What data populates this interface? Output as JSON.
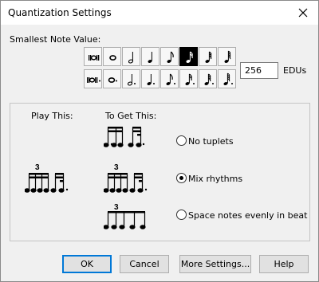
{
  "window": {
    "title": "Quantization Settings",
    "close_glyph": "close-icon"
  },
  "smallest_note": {
    "label": "Smallest Note Value:",
    "rows": [
      [
        "breve-double",
        "whole",
        "half",
        "quarter",
        "eighth",
        "16th",
        "32nd",
        "64th"
      ],
      [
        "dotted-breve-double",
        "dotted-whole",
        "dotted-half",
        "dotted-quarter",
        "dotted-eighth",
        "dotted-16th",
        "dotted-32nd",
        "dotted-64th"
      ]
    ],
    "selected": "16th",
    "edus_value": "256",
    "edus_label": "EDUs"
  },
  "playback": {
    "play_label": "Play This:",
    "get_label": "To Get This:",
    "triplet_marker": "3",
    "options": [
      {
        "label": "No tuplets",
        "checked": false
      },
      {
        "label": "Mix rhythms",
        "checked": true
      },
      {
        "label": "Space notes evenly in beat",
        "checked": false
      }
    ]
  },
  "buttons": {
    "ok": "OK",
    "cancel": "Cancel",
    "more": "More Settings...",
    "help": "Help"
  },
  "colors": {
    "accent": "#0078d7",
    "selected_cell": "#000000"
  }
}
